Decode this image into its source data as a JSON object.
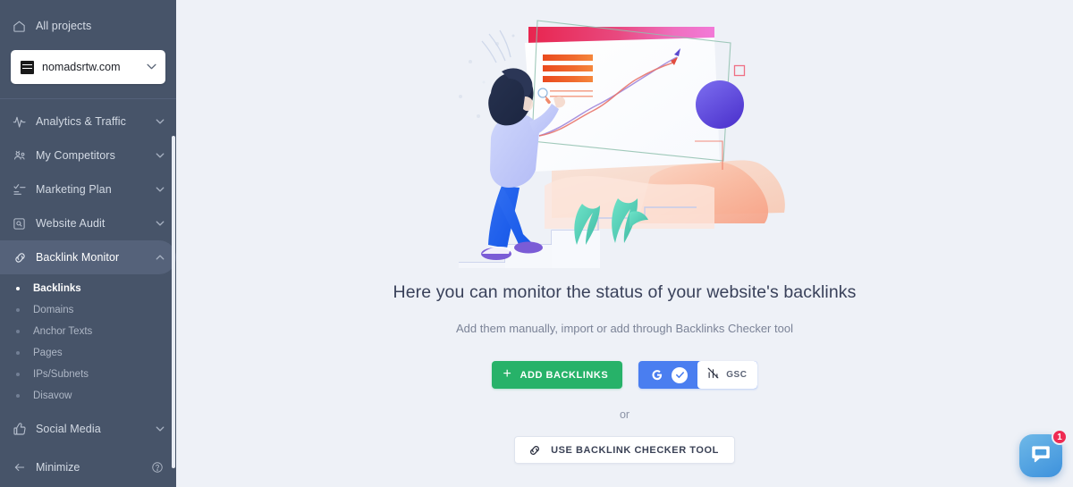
{
  "sidebar": {
    "all_projects_label": "All projects",
    "project": {
      "name": "nomadsrtw.com",
      "caret": "⌄"
    },
    "nav": [
      {
        "label": "Analytics & Traffic",
        "icon": "activity-pulse-icon",
        "chevron": "⌄"
      },
      {
        "label": "My Competitors",
        "icon": "competitors-people-icon",
        "chevron": "⌄"
      },
      {
        "label": "Marketing Plan",
        "icon": "checklist-icon",
        "chevron": "⌄"
      },
      {
        "label": "Website Audit",
        "icon": "audit-magnifier-icon",
        "chevron": "⌄"
      },
      {
        "label": "Backlink Monitor",
        "icon": "chain-link-icon",
        "chevron": "⌃"
      },
      {
        "label": "Social Media",
        "icon": "thumbs-up-icon",
        "chevron": "⌄"
      }
    ],
    "submenu": [
      {
        "label": "Backlinks"
      },
      {
        "label": "Domains"
      },
      {
        "label": "Anchor Texts"
      },
      {
        "label": "Pages"
      },
      {
        "label": "IPs/Subnets"
      },
      {
        "label": "Disavow"
      }
    ],
    "minimize_label": "Minimize",
    "bg_color": "#475469",
    "active_bg_color": "#55627a"
  },
  "main": {
    "headline": "Here you can monitor the status of your website's backlinks",
    "subline": "Add them manually, import or add through Backlinks Checker tool",
    "add_backlinks_label": "ADD BACKLINKS",
    "add_backlinks_plus": "+",
    "gsc": {
      "google_mark": "G",
      "check_mark": "✔",
      "label": "GSC"
    },
    "or_label": "or",
    "checker_label": "USE BACKLINK CHECKER TOOL",
    "accent_green": "#27b269",
    "accent_blue": "#4a7ef0",
    "bg_color": "#eef1f7"
  },
  "chat": {
    "badge_count": "1",
    "badge_color": "#ef2b53"
  }
}
